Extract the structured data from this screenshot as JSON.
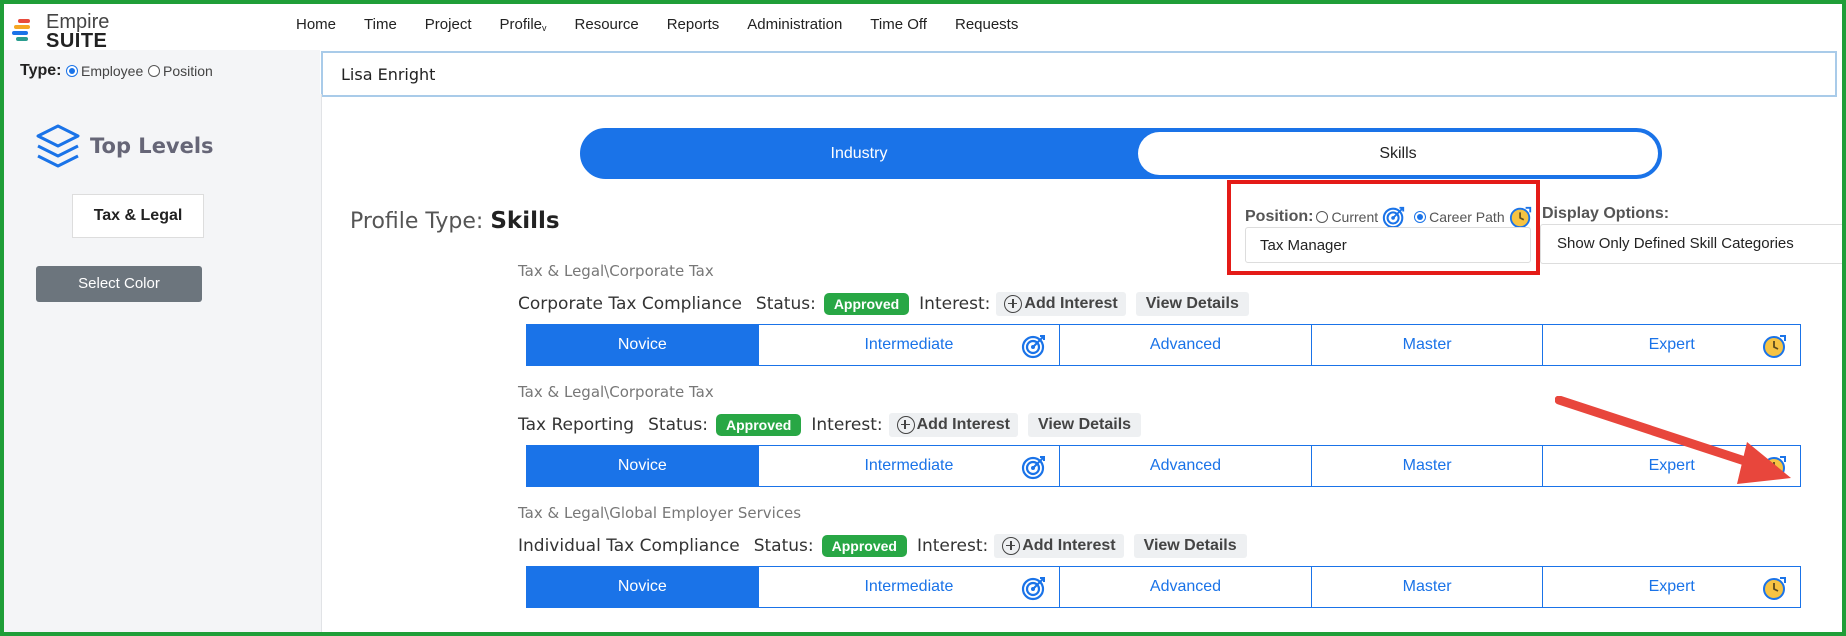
{
  "app": {
    "logo_line1": "Empire",
    "logo_line2": "SUITE",
    "nav": [
      "Home",
      "Time",
      "Project",
      "Profile",
      "Resource",
      "Reports",
      "Administration",
      "Time Off",
      "Requests"
    ]
  },
  "type_selector": {
    "label": "Type:",
    "options": [
      "Employee",
      "Position"
    ],
    "selected": "Employee"
  },
  "search": {
    "value": "Lisa Enright"
  },
  "sidebar": {
    "heading": "Top Levels",
    "item": "Tax & Legal",
    "select_color_label": "Select Color"
  },
  "toggle": {
    "left": "Industry",
    "right": "Skills",
    "selected": "Skills"
  },
  "profile_type": {
    "label": "Profile Type:",
    "value": "Skills"
  },
  "position": {
    "label": "Position:",
    "option_current": "Current",
    "option_career": "Career Path",
    "selected": "Career Path",
    "value": "Tax Manager"
  },
  "display_options": {
    "label": "Display Options:",
    "value": "Show Only Defined Skill Categories"
  },
  "labels": {
    "status": "Status:",
    "interest": "Interest:",
    "add_interest": "Add Interest",
    "view_details": "View Details"
  },
  "levels": [
    "Novice",
    "Intermediate",
    "Advanced",
    "Master",
    "Expert"
  ],
  "skills": [
    {
      "category": "Tax & Legal\\Corporate Tax",
      "name": "Corporate Tax Compliance",
      "status": "Approved",
      "current_level": "Novice"
    },
    {
      "category": "Tax & Legal\\Corporate Tax",
      "name": "Tax Reporting",
      "status": "Approved",
      "current_level": "Novice"
    },
    {
      "category": "Tax & Legal\\Global Employer Services",
      "name": "Individual Tax Compliance",
      "status": "Approved",
      "current_level": "Novice"
    }
  ],
  "colors": {
    "primary": "#1a73e8",
    "approved": "#28a745",
    "highlight_box": "#e41b17",
    "arrow": "#e8463c",
    "frame": "#1f9e38"
  },
  "icons": {
    "target": "target-icon",
    "career": "clock-icon"
  }
}
